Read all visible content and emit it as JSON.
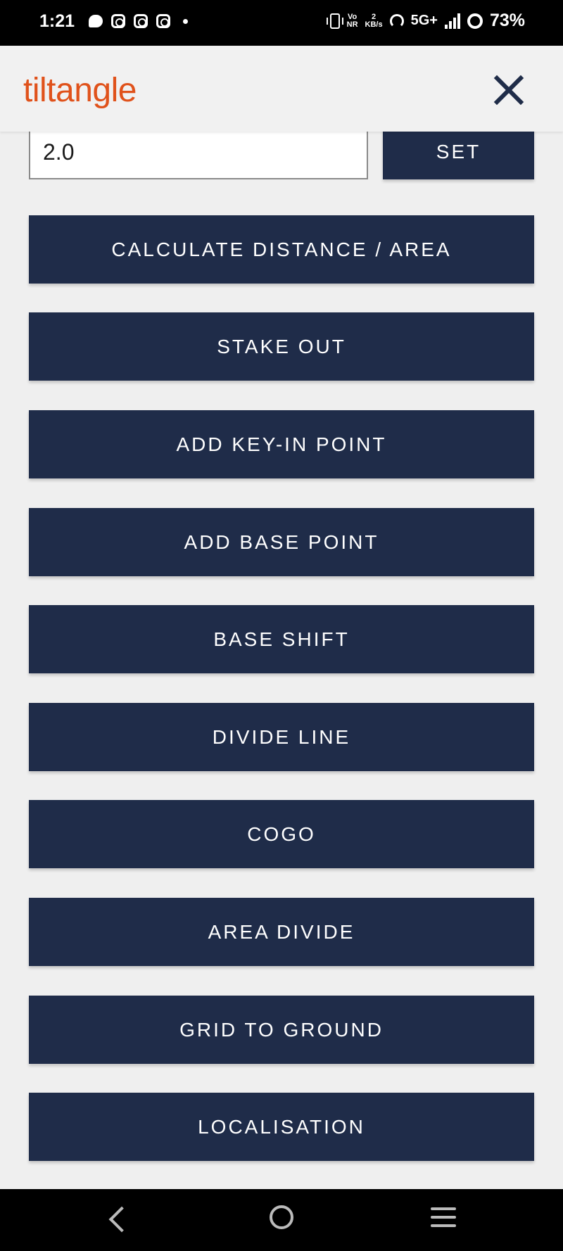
{
  "status_bar": {
    "time": "1:21",
    "network_top": "Vo",
    "network_bottom": "NR",
    "speed_top": "2",
    "speed_bottom": "KB/s",
    "network_type": "5G+",
    "battery": "73%"
  },
  "header": {
    "logo": "tiltangle",
    "logo_color": "#e0521b"
  },
  "input": {
    "value": "2.0"
  },
  "set_button": "SET",
  "buttons": [
    "CALCULATE DISTANCE / AREA",
    "STAKE OUT",
    "ADD KEY-IN POINT",
    "ADD BASE POINT",
    "BASE SHIFT",
    "DIVIDE LINE",
    "COGO",
    "AREA DIVIDE",
    "GRID TO GROUND",
    "LOCALISATION"
  ],
  "colors": {
    "button_bg": "#1f2c49",
    "page_bg": "#efefef"
  }
}
